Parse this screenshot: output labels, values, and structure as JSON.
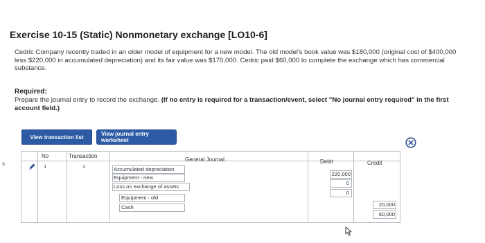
{
  "exercise": {
    "title": "Exercise 10-15 (Static) Nonmonetary exchange [LO10-6]",
    "paragraph": "Cedric Company recently traded in an older model of equipment for a new model. The old model's book value was $180,000 (original cost of $400,000 less $220,000 in accumulated depreciation) and its fair value was $170,000. Cedric paid $60,000 to complete the exchange which has commercial substance.",
    "required_label": "Required:",
    "instructions_plain": "Prepare the journal entry to record the exchange. ",
    "instructions_bold": "(If no entry is required for a transaction/event, select \"No journal entry required\" in the first account field.)"
  },
  "buttons": {
    "view_transaction_list": "View transaction list",
    "view_journal_entry_worksheet": "View journal entry worksheet"
  },
  "icons": {
    "close": "close-icon",
    "edit": "pencil-icon",
    "cursor": "mouse-pointer-icon"
  },
  "left_edge_mark": "s",
  "journal": {
    "headers": {
      "no": "No",
      "transaction": "Transaction",
      "general_journal": "General Journal",
      "debit": "Debit",
      "credit": "Credit"
    },
    "rows": [
      {
        "no": "1",
        "transaction": "1",
        "account": "Accumulated depreciation",
        "debit": "220,000",
        "credit": ""
      },
      {
        "no": "",
        "transaction": "",
        "account": "Equipment - new",
        "debit": "0",
        "credit": ""
      },
      {
        "no": "",
        "transaction": "",
        "account": "Loss on exchange of assets",
        "debit": "0",
        "credit": ""
      },
      {
        "no": "",
        "transaction": "",
        "account": "Equipment - old",
        "debit": "",
        "credit": "20,000"
      },
      {
        "no": "",
        "transaction": "",
        "account": "Cash",
        "debit": "",
        "credit": "60,000"
      }
    ]
  },
  "colors": {
    "button_blue": "#2d5aa5",
    "close_icon": "#2d4f8f",
    "grid": "#b8bec6"
  }
}
